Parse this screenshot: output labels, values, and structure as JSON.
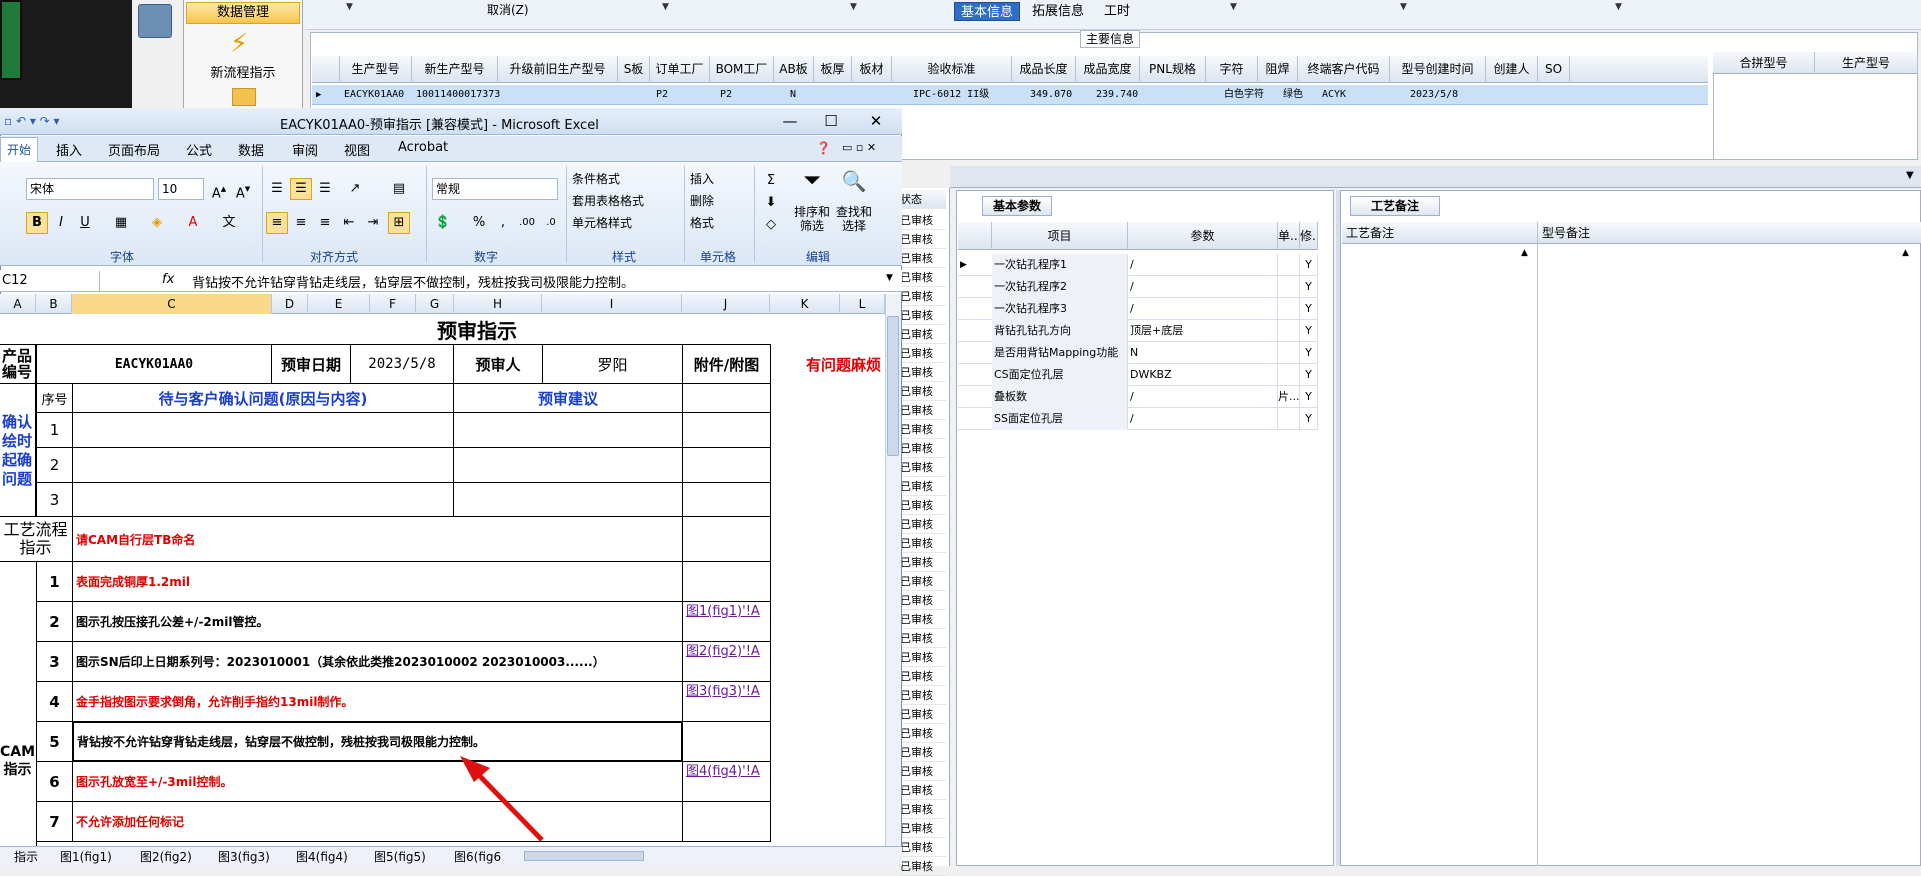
{
  "nav": {
    "header": "数据管理",
    "new_flow": "新流程指示"
  },
  "topbar": {
    "cancel": "取消(Z)"
  },
  "main": {
    "group_title": "主要信息",
    "columns": [
      "生产型号",
      "新生产型号",
      "升级前旧生产型号",
      "S板",
      "订单工厂",
      "BOM工厂",
      "AB板",
      "板厚",
      "板材",
      "验收标准",
      "成品长度",
      "成品宽度",
      "PNL规格",
      "字符",
      "阻焊",
      "终端客户代码",
      "型号创建时间",
      "创建人",
      "SO"
    ],
    "row": [
      "EACYK01AA0",
      "10011400017373",
      "",
      "",
      "P2",
      "P2",
      "N",
      "",
      "",
      "IPC-6012 II级",
      "349.070",
      "239.740",
      "",
      "白色字符",
      "绿色",
      "ACYK",
      "2023/5/8",
      "",
      ""
    ],
    "merge_columns": [
      "合拼型号",
      "生产型号"
    ]
  },
  "right": {
    "tabs": [
      "基本信息",
      "拓展信息",
      "工时"
    ],
    "basic_tab": "基本参数",
    "param_columns": [
      "项目",
      "参数",
      "单...",
      "修..."
    ],
    "params": [
      {
        "item": "一次钻孔程序1",
        "value": "/",
        "unit": "",
        "flag": "Y"
      },
      {
        "item": "一次钻孔程序2",
        "value": "/",
        "unit": "",
        "flag": "Y"
      },
      {
        "item": "一次钻孔程序3",
        "value": "/",
        "unit": "",
        "flag": "Y"
      },
      {
        "item": "背钻孔钻孔方向",
        "value": "顶层+底层",
        "unit": "",
        "flag": "Y"
      },
      {
        "item": "是否用背钻Mapping功能",
        "value": "N",
        "unit": "",
        "flag": "Y"
      },
      {
        "item": "CS面定位孔层",
        "value": "DWKBZ",
        "unit": "",
        "flag": "Y"
      },
      {
        "item": "叠板数",
        "value": "/",
        "unit": "片...",
        "flag": "Y"
      },
      {
        "item": "SS面定位孔层",
        "value": "/",
        "unit": "",
        "flag": "Y"
      }
    ],
    "craft_tab": "工艺备注",
    "craft_columns": [
      "工艺备注",
      "型号备注"
    ],
    "status_header": "状态",
    "status_cell": "已审核"
  },
  "excel": {
    "title": "EACYK01AA0-预审指示 [兼容模式] - Microsoft Excel",
    "ribbon_tabs": [
      "开始",
      "插入",
      "页面布局",
      "公式",
      "数据",
      "审阅",
      "视图",
      "Acrobat"
    ],
    "groups": [
      "字体",
      "对齐方式",
      "数字",
      "样式",
      "单元格",
      "编辑"
    ],
    "font_name": "宋体",
    "font_size": "10",
    "number_format": "常规",
    "style_items": [
      "条件格式",
      "套用表格格式",
      "单元格样式"
    ],
    "cell_items": [
      "插入",
      "删除",
      "格式"
    ],
    "edit_items": [
      "排序和筛选",
      "查找和选择"
    ],
    "name_box": "C12",
    "formula": "背钻按不允许钻穿背钻走线层，钻穿层不做控制，残桩按我司极限能力控制。",
    "col_letters": [
      "A",
      "B",
      "C",
      "D",
      "E",
      "F",
      "G",
      "H",
      "I",
      "J",
      "K",
      "L"
    ],
    "sheet": {
      "title": "预审指示",
      "product_label": "产品编号",
      "product_code": "EACYK01AA0",
      "date_label": "预审日期",
      "date_value": "2023/5/8",
      "reviewer_label": "预审人",
      "reviewer_value": "罗阳",
      "attach_label": "附件/附图",
      "trouble_note": "有问题麻烦",
      "seq_label": "序号",
      "question_header": "待与客户确认问题(原因与内容)",
      "suggestion_header": "预审建议",
      "confirm_label": "确认绘时起确问题",
      "q_rows": [
        "1",
        "2",
        "3"
      ],
      "process_label": "工艺流程指示",
      "process_note": "请CAM自行层TB命名",
      "cam_label": "CAM指示",
      "instructions": [
        {
          "no": "1",
          "text": "表面完成铜厚1.2mil",
          "color": "red",
          "link": ""
        },
        {
          "no": "2",
          "text": "图示孔按压接孔公差+/-2mil管控。",
          "color": "black",
          "link": "图1(fig1)'!A"
        },
        {
          "no": "3",
          "text": "图示SN后印上日期系列号：2023010001（其余依此类推2023010002 2023010003......）",
          "color": "black",
          "link": "图2(fig2)'!A"
        },
        {
          "no": "4",
          "text": "金手指按图示要求倒角，允许削手指约13mil制作。",
          "color": "red",
          "link": "图3(fig3)'!A"
        },
        {
          "no": "5",
          "text": "背钻按不允许钻穿背钻走线层，钻穿层不做控制，残桩按我司极限能力控制。",
          "color": "black",
          "link": ""
        },
        {
          "no": "6",
          "text": "图示孔放宽至+/-3mil控制。",
          "color": "red",
          "link": "图4(fig4)'!A"
        },
        {
          "no": "7",
          "text": "不允许添加任何标记",
          "color": "red",
          "link": ""
        }
      ]
    },
    "sheet_tabs": [
      "指示",
      "图1(fig1)",
      "图2(fig2)",
      "图3(fig3)",
      "图4(fig4)",
      "图5(fig5)",
      "图6(fig6"
    ]
  },
  "colors": {
    "accent": "#2e6ec7",
    "selected_row": "#c9e0f7",
    "red_text": "#e00000",
    "blue_text": "#1a3fd0",
    "arrow": "#e01010"
  }
}
